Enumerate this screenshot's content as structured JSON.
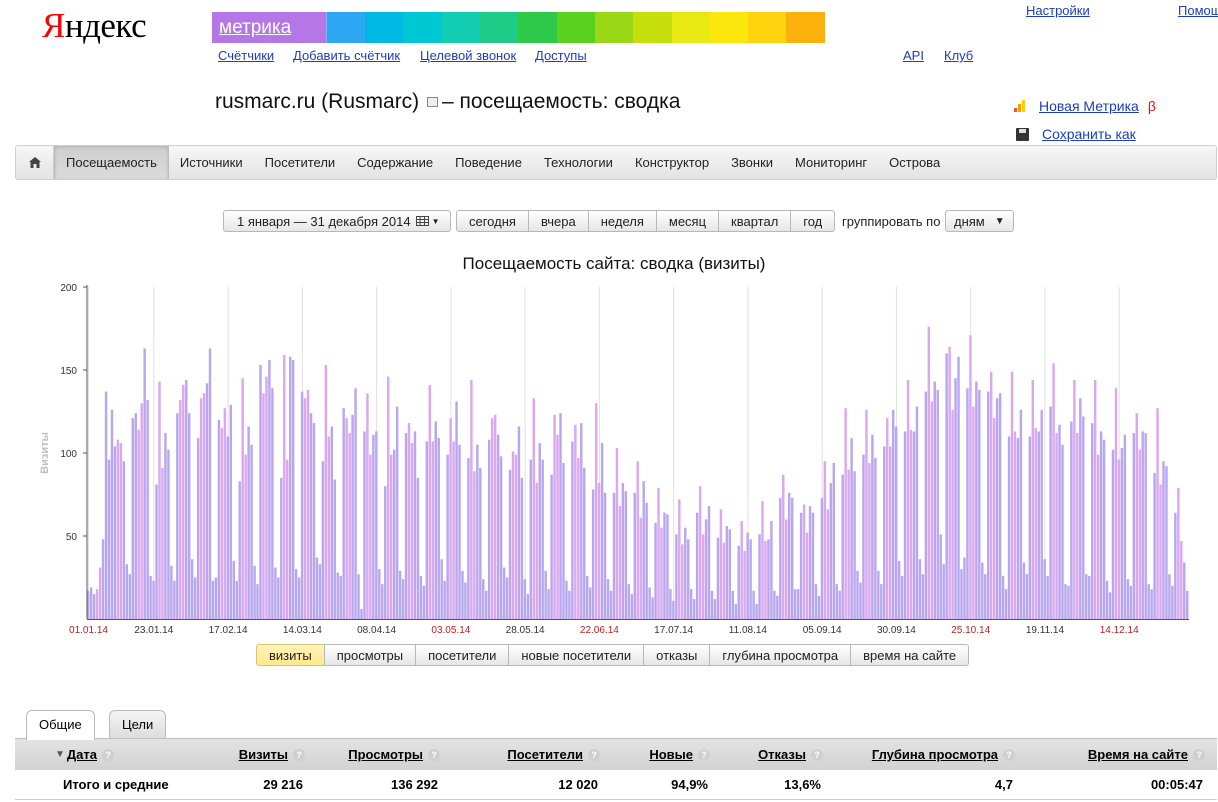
{
  "header": {
    "logo_first": "Я",
    "logo_rest": "ндекс",
    "product": "метрика",
    "rainbow_colors": [
      "#c38bf0",
      "#a99cf5",
      "#8cb0f7",
      "#2da7f4",
      "#00b9e5",
      "#00c7d4",
      "#12cdb2",
      "#1fcc87",
      "#2fc94a",
      "#5ad11f",
      "#9ad717",
      "#c5df0c",
      "#e8e812",
      "#fbe70b",
      "#fdd40e",
      "#fbb10c"
    ],
    "links": {
      "counters": "Счётчики",
      "add_counter": "Добавить счётчик",
      "target_call": "Целевой звонок",
      "access": "Доступы",
      "api": "API",
      "club": "Клуб",
      "settings": "Настройки",
      "help": "Помощь"
    }
  },
  "title": {
    "site": "rusmarc.ru (Rusmarc)",
    "suffix": "– посещаемость: сводка"
  },
  "side_links": {
    "new_metrika": "Новая Метрика",
    "beta": "β",
    "save_as": "Сохранить как"
  },
  "nav": {
    "items": [
      "Посещаемость",
      "Источники",
      "Посетители",
      "Содержание",
      "Поведение",
      "Технологии",
      "Конструктор",
      "Звонки",
      "Мониторинг",
      "Острова"
    ],
    "active": 0
  },
  "toolbar": {
    "date_range": "1 января — 31 декабря 2014",
    "periods": [
      "сегодня",
      "вчера",
      "неделя",
      "месяц",
      "квартал",
      "год"
    ],
    "group_label": "группировать по",
    "group_value": "дням"
  },
  "chart_data": {
    "type": "bar",
    "title": "Посещаемость сайта: сводка (визиты)",
    "ylabel": "Визиты",
    "ylim": [
      0,
      200
    ],
    "yticks": [
      50,
      100,
      150,
      200
    ],
    "x_ticks": [
      {
        "label": "01.01.14",
        "day": 0,
        "red": true
      },
      {
        "label": "23.01.14",
        "day": 22,
        "red": false
      },
      {
        "label": "17.02.14",
        "day": 47,
        "red": false
      },
      {
        "label": "14.03.14",
        "day": 72,
        "red": false
      },
      {
        "label": "08.04.14",
        "day": 97,
        "red": false
      },
      {
        "label": "03.05.14",
        "day": 122,
        "red": true
      },
      {
        "label": "28.05.14",
        "day": 147,
        "red": false
      },
      {
        "label": "22.06.14",
        "day": 172,
        "red": true
      },
      {
        "label": "17.07.14",
        "day": 197,
        "red": false
      },
      {
        "label": "11.08.14",
        "day": 222,
        "red": false
      },
      {
        "label": "05.09.14",
        "day": 247,
        "red": false
      },
      {
        "label": "30.09.14",
        "day": 272,
        "red": false
      },
      {
        "label": "25.10.14",
        "day": 297,
        "red": true
      },
      {
        "label": "19.11.14",
        "day": 322,
        "red": false
      },
      {
        "label": "14.12.14",
        "day": 347,
        "red": true
      }
    ],
    "grid": true,
    "series": [
      {
        "name": "визиты",
        "color": "#b9a6f0",
        "weekend_color": "#dba8ef",
        "values": [
          17,
          19,
          15,
          18,
          31,
          48,
          137,
          96,
          126,
          104,
          108,
          106,
          95,
          33,
          27,
          121,
          124,
          114,
          130,
          163,
          132,
          26,
          23,
          81,
          143,
          91,
          112,
          102,
          32,
          23,
          124,
          132,
          141,
          144,
          124,
          36,
          25,
          109,
          133,
          136,
          142,
          163,
          23,
          25,
          120,
          115,
          127,
          110,
          129,
          35,
          23,
          83,
          145,
          99,
          116,
          105,
          32,
          21,
          153,
          136,
          146,
          156,
          139,
          31,
          25,
          85,
          159,
          96,
          158,
          156,
          30,
          25,
          137,
          133,
          138,
          124,
          118,
          37,
          33,
          95,
          153,
          110,
          116,
          84,
          28,
          26,
          127,
          121,
          112,
          123,
          139,
          27,
          6,
          113,
          136,
          99,
          111,
          113,
          30,
          21,
          80,
          146,
          99,
          102,
          128,
          29,
          24,
          112,
          118,
          106,
          113,
          85,
          26,
          20,
          107,
          141,
          107,
          119,
          109,
          36,
          23,
          99,
          121,
          107,
          131,
          105,
          29,
          22,
          97,
          144,
          89,
          105,
          91,
          24,
          17,
          108,
          121,
          123,
          111,
          98,
          31,
          25,
          90,
          101,
          99,
          116,
          85,
          24,
          15,
          96,
          133,
          82,
          106,
          96,
          29,
          18,
          87,
          123,
          111,
          124,
          94,
          23,
          17,
          107,
          117,
          97,
          118,
          91,
          26,
          19,
          78,
          130,
          82,
          106,
          76,
          24,
          17,
          76,
          103,
          68,
          82,
          77,
          21,
          15,
          76,
          95,
          61,
          83,
          70,
          19,
          13,
          58,
          79,
          55,
          64,
          63,
          18,
          11,
          51,
          72,
          45,
          55,
          48,
          18,
          12,
          64,
          80,
          51,
          60,
          68,
          17,
          12,
          49,
          66,
          46,
          56,
          54,
          17,
          9,
          44,
          59,
          41,
          52,
          48,
          17,
          9,
          51,
          71,
          47,
          48,
          59,
          17,
          14,
          73,
          87,
          60,
          76,
          73,
          18,
          18,
          64,
          69,
          52,
          68,
          64,
          21,
          14,
          73,
          95,
          66,
          82,
          94,
          21,
          17,
          87,
          127,
          90,
          109,
          89,
          29,
          22,
          99,
          126,
          94,
          111,
          97,
          29,
          21,
          104,
          121,
          104,
          126,
          116,
          35,
          26,
          113,
          144,
          114,
          113,
          128,
          36,
          27,
          137,
          176,
          131,
          143,
          138,
          51,
          33,
          160,
          164,
          126,
          145,
          158,
          30,
          37,
          139,
          171,
          128,
          143,
          138,
          34,
          27,
          137,
          149,
          121,
          133,
          136,
          26,
          18,
          110,
          149,
          113,
          109,
          126,
          34,
          27,
          110,
          144,
          115,
          113,
          126,
          36,
          26,
          128,
          154,
          112,
          117,
          105,
          21,
          20,
          119,
          144,
          112,
          133,
          122,
          27,
          26,
          118,
          144,
          99,
          113,
          108,
          23,
          16,
          102,
          139,
          96,
          103,
          111,
          24,
          20,
          112,
          124,
          102,
          113,
          112,
          21,
          18,
          88,
          127,
          81,
          95,
          92,
          27,
          20,
          64,
          79,
          47,
          34,
          17
        ]
      }
    ]
  },
  "metric_tabs": {
    "items": [
      "визиты",
      "просмотры",
      "посетители",
      "новые посетители",
      "отказы",
      "глубина просмотра",
      "время на сайте"
    ],
    "active": 0
  },
  "table": {
    "tabs": [
      "Общие",
      "Цели"
    ],
    "columns": [
      {
        "label": "Дата",
        "align": "l"
      },
      {
        "label": "Визиты",
        "align": "r"
      },
      {
        "label": "Просмотры",
        "align": "r"
      },
      {
        "label": "Посетители",
        "align": "r"
      },
      {
        "label": "Новые",
        "align": "r"
      },
      {
        "label": "Отказы",
        "align": "r"
      },
      {
        "label": "Глубина просмотра",
        "align": "r"
      },
      {
        "label": "Время на сайте",
        "align": "r"
      }
    ],
    "totals": [
      "Итого и средние",
      "29 216",
      "136 292",
      "12 020",
      "94,9%",
      "13,6%",
      "4,7",
      "00:05:47"
    ]
  }
}
